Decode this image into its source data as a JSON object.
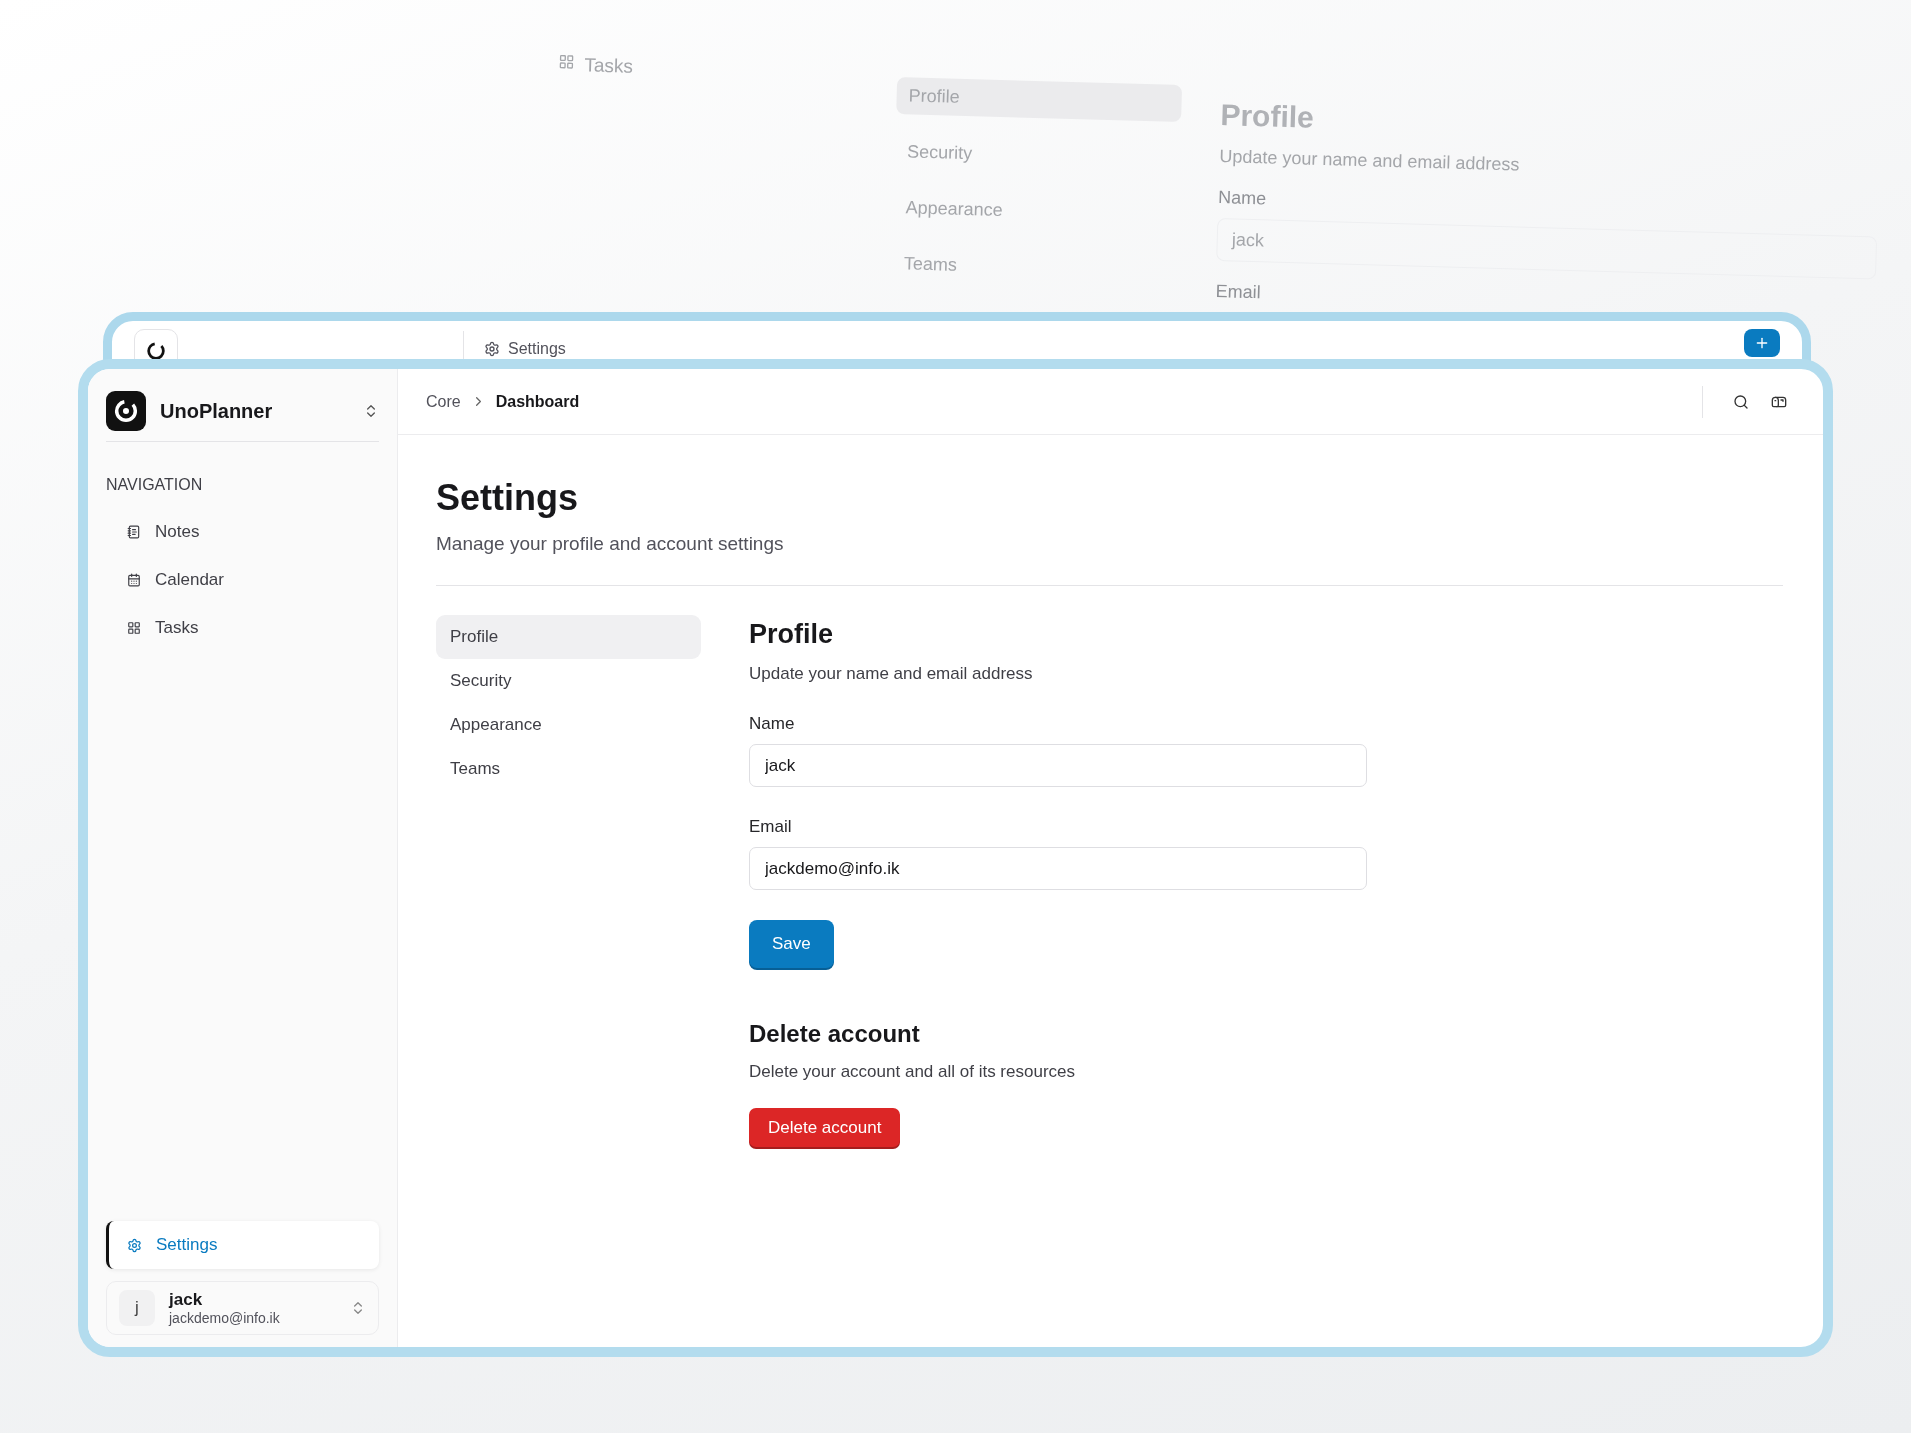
{
  "backdrop": {
    "nav_item": "Tasks",
    "tabs": [
      {
        "label": "Profile",
        "selected": true
      },
      {
        "label": "Security",
        "selected": false
      },
      {
        "label": "Appearance",
        "selected": false
      },
      {
        "label": "Teams",
        "selected": false
      }
    ],
    "heading": "Profile",
    "description": "Update your name and email address",
    "name_label": "Name",
    "name_value": "jack",
    "email_label": "Email"
  },
  "back_window": {
    "breadcrumb": "Settings"
  },
  "sidebar": {
    "app_name": "UnoPlanner",
    "section_label": "NAVIGATION",
    "items": [
      {
        "label": "Notes",
        "selected": false
      },
      {
        "label": "Calendar",
        "selected": false
      },
      {
        "label": "Tasks",
        "selected": false
      }
    ],
    "footer_item": {
      "label": "Settings",
      "selected": true
    },
    "user": {
      "initial": "j",
      "name": "jack",
      "email": "jackdemo@info.ik"
    }
  },
  "breadcrumb": [
    "Core",
    "Dashboard"
  ],
  "page": {
    "title": "Settings",
    "subtitle": "Manage your profile and account settings"
  },
  "tabs": [
    {
      "label": "Profile",
      "selected": true
    },
    {
      "label": "Security",
      "selected": false
    },
    {
      "label": "Appearance",
      "selected": false
    },
    {
      "label": "Teams",
      "selected": false
    }
  ],
  "profile": {
    "heading": "Profile",
    "description": "Update your name and email address",
    "fields": [
      {
        "label": "Name",
        "value": "jack"
      },
      {
        "label": "Email",
        "value": "jackdemo@info.ik"
      }
    ],
    "save_button": "Save"
  },
  "delete_section": {
    "heading": "Delete account",
    "description": "Delete your account and all of its resources",
    "button": "Delete account"
  }
}
